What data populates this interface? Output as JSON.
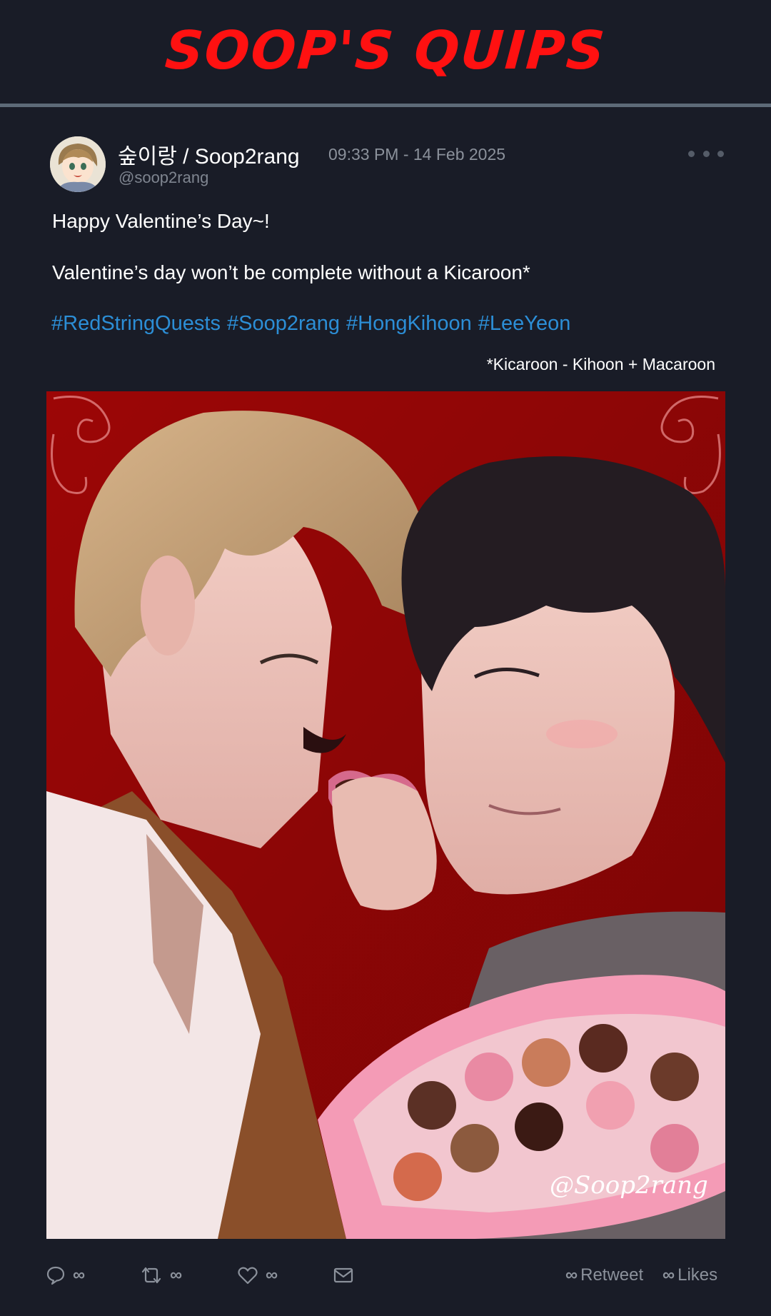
{
  "header": {
    "site_title": "SOOP'S QUIPS"
  },
  "post": {
    "display_name": "숲이랑 / Soop2rang",
    "timestamp": "09:33 PM - 14 Feb 2025",
    "handle": "@soop2rang",
    "line1": "Happy Valentine’s Day~!",
    "line2": "Valentine’s day won’t be complete without a Kicaroon*",
    "hashtags": [
      "#RedStringQuests",
      "#Soop2rang",
      "#HongKihoon",
      "#LeeYeon"
    ],
    "footnote": "*Kicaroon - Kihoon + Macaroon",
    "artwork_signature": "@Soop2rang"
  },
  "actions": {
    "reply_count": "∞",
    "retweet_count": "∞",
    "like_count": "∞"
  },
  "stats": {
    "retweet_value": "∞",
    "retweet_label": "Retweet",
    "likes_value": "∞",
    "likes_label": "Likes"
  },
  "colors": {
    "background": "#191c27",
    "title_red": "#ff1111",
    "hashtag_blue": "#2c8ed6",
    "muted_text": "#8b919b",
    "divider": "#5d6a78"
  },
  "icons": [
    "reply-icon",
    "retweet-icon",
    "heart-icon",
    "envelope-icon",
    "more-dots-icon"
  ]
}
